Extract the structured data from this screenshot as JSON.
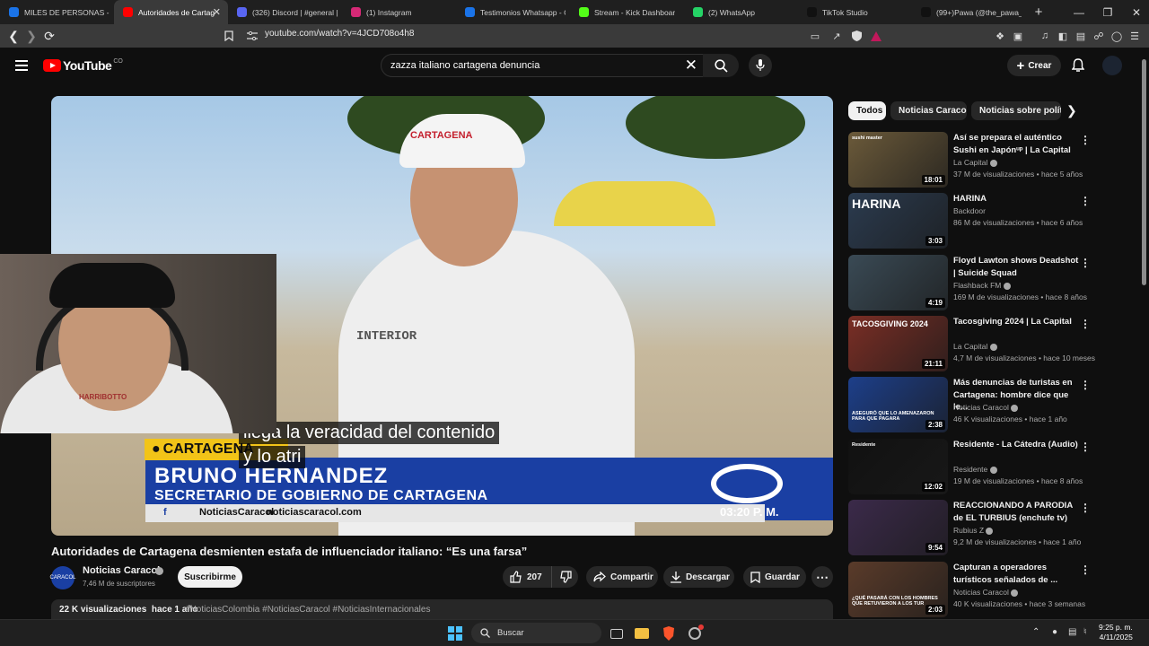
{
  "browser": {
    "tabs": [
      {
        "label": "MILES DE PERSONAS - Go",
        "favicon_color": "#1a73e8",
        "active": false
      },
      {
        "label": "Autoridades de Cartag",
        "favicon_color": "#ff0000",
        "active": true
      },
      {
        "label": "(326) Discord | #general | F",
        "favicon_color": "#5865f2",
        "active": false
      },
      {
        "label": "(1) Instagram",
        "favicon_color": "#d62976",
        "active": false
      },
      {
        "label": "Testimonios Whatsapp - G",
        "favicon_color": "#1a73e8",
        "active": false
      },
      {
        "label": "Stream - Kick Dashboar",
        "favicon_color": "#53fc18",
        "active": false
      },
      {
        "label": "(2) WhatsApp",
        "favicon_color": "#25d366",
        "active": false
      },
      {
        "label": "TikTok Studio",
        "favicon_color": "#111111",
        "active": false
      },
      {
        "label": "(99+)Pawa (@the_pawa_c",
        "favicon_color": "#111111",
        "active": false
      }
    ],
    "url": "youtube.com/watch?v=4JCD708o4h8"
  },
  "youtube": {
    "logo_text": "YouTube",
    "logo_country": "CO",
    "search_query": "zazza italiano cartagena denuncia",
    "create_label": "Crear"
  },
  "video": {
    "cap_text": "CARTAGENA",
    "jacket_text": "INTERIOR",
    "lower_third": {
      "city": "CARTAGENA",
      "name": "BRUNO HERNANDEZ",
      "role": "SECRETARIO DE GOBIERNO DE CARTAGENA",
      "brand_name": "NoticiasCaracol",
      "brand_url": "noticiascaracol.com",
      "time": "03:20 P. M."
    },
    "captions": [
      "llega la veracidad del contenido",
      "y lo atri"
    ],
    "webcam_cap_text": "HARRIBOTTO"
  },
  "details": {
    "title": "Autoridades de Cartagena desmienten estafa de influenciador italiano: “Es una farsa”",
    "channel_name": "Noticias Caracol",
    "channel_avatar_text": "CARACOL",
    "subscribers": "7,46 M de suscriptores",
    "subscribe_label": "Suscribirme",
    "likes": "207",
    "share_label": "Compartir",
    "download_label": "Descargar",
    "save_label": "Guardar",
    "views": "22 K visualizaciones",
    "age": "hace 1 año",
    "tags": "#NoticiasColombia #NoticiasCaracol #NoticiasInternacionales"
  },
  "sidebar": {
    "chips": [
      "Todos",
      "Noticias Caracol",
      "Noticias sobre política"
    ],
    "recommendations": [
      {
        "title": "Así se prepara el auténtico Sushi en Japónᵘᵖ | La Capital",
        "channel": "La Capital",
        "verified": true,
        "meta": "37 M de visualizaciones • hace 5 años",
        "duration": "18:01",
        "thumb_color": "#6b5a3a",
        "thumb_text": "sushi master"
      },
      {
        "title": "HARINA",
        "channel": "Backdoor",
        "verified": false,
        "meta": "86 M de visualizaciones • hace 6 años",
        "duration": "3:03",
        "thumb_color": "#2b3b4f",
        "thumb_text": "HARINA"
      },
      {
        "title": "Floyd Lawton shows Deadshot | Suicide Squad",
        "channel": "Flashback FM",
        "verified": true,
        "meta": "169 M de visualizaciones • hace 8 años",
        "duration": "4:19",
        "thumb_color": "#3a4a55",
        "thumb_text": ""
      },
      {
        "title": "Tacosgiving 2024 | La Capital",
        "channel": "La Capital",
        "verified": true,
        "meta": "4,7 M de visualizaciones • hace 10 meses",
        "duration": "21:11",
        "thumb_color": "#7a2e25",
        "thumb_text": "TACOSGIVING 2024"
      },
      {
        "title": "Más denuncias de turistas en Cartagena: hombre dice que le...",
        "channel": "Noticias Caracol",
        "verified": true,
        "meta": "46 K visualizaciones • hace 1 año",
        "duration": "2:38",
        "thumb_color": "#1d3f8a",
        "thumb_text": "ASEGURÓ QUE LO AMENAZARON PARA QUE PAGARA"
      },
      {
        "title": "Residente - La Cátedra (Audio)",
        "channel": "Residente",
        "verified": true,
        "meta": "19 M de visualizaciones • hace 8 años",
        "duration": "12:02",
        "thumb_color": "#111111",
        "thumb_text": "Residente"
      },
      {
        "title": "REACCIONANDO A PARODIA de EL TURBIUS (enchufe tv)",
        "channel": "Rubius Z",
        "verified": true,
        "meta": "9,2 M de visualizaciones • hace 1 año",
        "duration": "9:54",
        "thumb_color": "#3b2a4a",
        "thumb_text": ""
      },
      {
        "title": "Capturan a operadores turísticos señalados de ...",
        "channel": "Noticias Caracol",
        "verified": true,
        "meta": "40 K visualizaciones • hace 3 semanas",
        "duration": "2:03",
        "thumb_color": "#5a3b2a",
        "thumb_text": "¿QUÉ PASARÁ CON LOS HOMBRES QUE RETUVIERON A LOS TUR"
      }
    ]
  },
  "taskbar": {
    "search_placeholder": "Buscar",
    "time": "9:25 p. m.",
    "date": "4/11/2025"
  }
}
